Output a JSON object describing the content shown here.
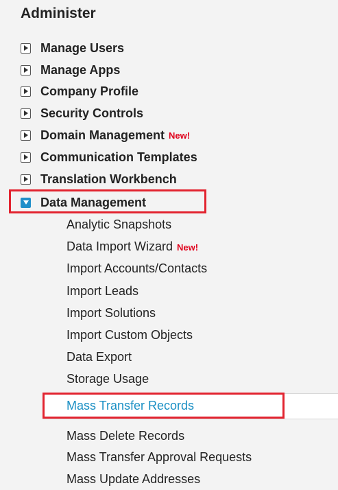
{
  "sidebar": {
    "title": "Administer",
    "items": [
      {
        "label": "Manage Users",
        "badge": ""
      },
      {
        "label": "Manage Apps",
        "badge": ""
      },
      {
        "label": "Company Profile",
        "badge": ""
      },
      {
        "label": "Security Controls",
        "badge": ""
      },
      {
        "label": "Domain Management",
        "badge": "New!"
      },
      {
        "label": "Communication Templates",
        "badge": ""
      },
      {
        "label": "Translation Workbench",
        "badge": ""
      },
      {
        "label": "Data Management",
        "badge": "",
        "expanded": true
      }
    ],
    "sub_items": [
      {
        "label": "Analytic Snapshots",
        "badge": ""
      },
      {
        "label": "Data Import Wizard",
        "badge": "New!"
      },
      {
        "label": "Import Accounts/Contacts",
        "badge": ""
      },
      {
        "label": "Import Leads",
        "badge": ""
      },
      {
        "label": "Import Solutions",
        "badge": ""
      },
      {
        "label": "Import Custom Objects",
        "badge": ""
      },
      {
        "label": "Data Export",
        "badge": ""
      },
      {
        "label": "Storage Usage",
        "badge": ""
      },
      {
        "label": "Mass Transfer Records",
        "badge": "",
        "selected": true
      },
      {
        "label": "Mass Delete Records",
        "badge": ""
      },
      {
        "label": "Mass Transfer Approval Requests",
        "badge": ""
      },
      {
        "label": "Mass Update Addresses",
        "badge": ""
      }
    ]
  },
  "colors": {
    "accent": "#1f8fc9",
    "selected_text": "#1a8fc4",
    "new_badge": "#e0001b",
    "highlight_border": "#e2232f"
  }
}
